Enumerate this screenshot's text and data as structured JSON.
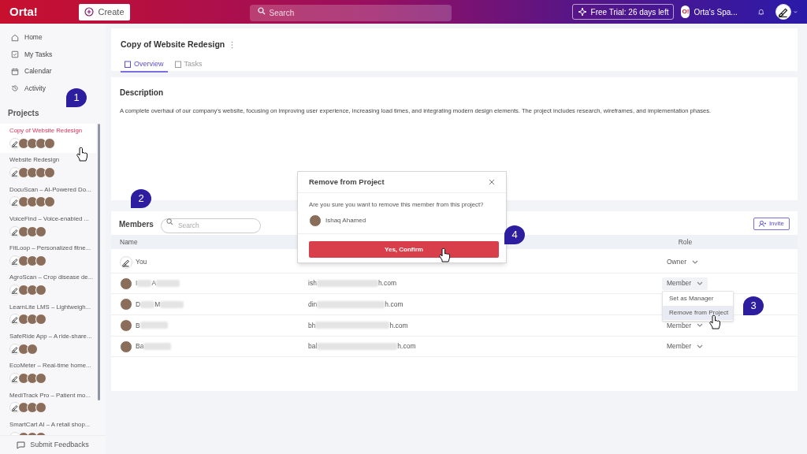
{
  "header": {
    "logo": "Orta!",
    "create_button": "Create",
    "search": {
      "placeholder": "Search"
    },
    "trial_badge": "Free Trial: 26 days left",
    "workspace": "Orta's Spa...",
    "workspace_logo": "O!"
  },
  "sidebar": {
    "nav": [
      {
        "label": "Home"
      },
      {
        "label": "My Tasks"
      },
      {
        "label": "Calendar"
      },
      {
        "label": "Activity"
      }
    ],
    "projects_heading": "Projects",
    "projects": [
      {
        "name": "Copy of Website Redesign",
        "selected": true,
        "avatars": [
          {
            "kind": "sketch"
          },
          {
            "kind": "photo"
          },
          {
            "kind": "photo"
          },
          {
            "kind": "photo"
          },
          {
            "kind": "photo"
          }
        ]
      },
      {
        "name": "Website Redesign",
        "selected": false,
        "avatars": [
          {
            "kind": "sketch"
          },
          {
            "kind": "photo"
          },
          {
            "kind": "photo"
          },
          {
            "kind": "photo"
          },
          {
            "kind": "photo"
          }
        ]
      },
      {
        "name": "DocuScan – AI-Powered Do...",
        "selected": false,
        "avatars": [
          {
            "kind": "sketch"
          },
          {
            "kind": "photo"
          },
          {
            "kind": "photo"
          },
          {
            "kind": "photo"
          },
          {
            "kind": "photo"
          }
        ]
      },
      {
        "name": "VoiceFind – Voice-enabled ...",
        "selected": false,
        "avatars": [
          {
            "kind": "sketch"
          },
          {
            "kind": "photo"
          },
          {
            "kind": "photo"
          },
          {
            "kind": "photo"
          }
        ]
      },
      {
        "name": "FitLoop – Personalized fitne...",
        "selected": false,
        "avatars": [
          {
            "kind": "sketch"
          },
          {
            "kind": "photo"
          },
          {
            "kind": "photo"
          },
          {
            "kind": "photo"
          }
        ]
      },
      {
        "name": "AgroScan – Crop disease de...",
        "selected": false,
        "avatars": [
          {
            "kind": "sketch"
          },
          {
            "kind": "photo"
          },
          {
            "kind": "photo"
          },
          {
            "kind": "photo"
          }
        ]
      },
      {
        "name": "LearnLite LMS – Lightweigh...",
        "selected": false,
        "avatars": [
          {
            "kind": "sketch"
          },
          {
            "kind": "photo"
          },
          {
            "kind": "photo"
          },
          {
            "kind": "photo"
          }
        ]
      },
      {
        "name": "SafeRide App – A ride-share...",
        "selected": false,
        "avatars": [
          {
            "kind": "sketch"
          },
          {
            "kind": "photo"
          },
          {
            "kind": "photo"
          }
        ]
      },
      {
        "name": "EcoMeter – Real-time home...",
        "selected": false,
        "avatars": [
          {
            "kind": "sketch"
          },
          {
            "kind": "photo"
          },
          {
            "kind": "photo"
          },
          {
            "kind": "photo"
          }
        ]
      },
      {
        "name": "MediTrack Pro – Patient mo...",
        "selected": false,
        "avatars": [
          {
            "kind": "sketch"
          },
          {
            "kind": "photo"
          },
          {
            "kind": "photo"
          },
          {
            "kind": "photo"
          }
        ]
      },
      {
        "name": "SmartCart AI – A retail shop...",
        "selected": false,
        "avatars": [
          {
            "kind": "sketch"
          },
          {
            "kind": "photo"
          },
          {
            "kind": "photo"
          },
          {
            "kind": "photo"
          }
        ]
      }
    ],
    "feedback": "Submit Feedbacks"
  },
  "project": {
    "title": "Copy of Website Redesign",
    "tabs": [
      {
        "label": "Overview",
        "selected": true
      },
      {
        "label": "Tasks",
        "selected": false
      }
    ]
  },
  "description": {
    "heading": "Description",
    "text": "A complete overhaul of our company's website, focusing on improving user experience, increasing load times, and integrating modern design elements. The project includes research, wireframes, and implementation phases."
  },
  "members": {
    "heading": "Members",
    "search": {
      "placeholder": "Search"
    },
    "invite_button": "Invite",
    "columns": {
      "name": "Name",
      "role": "Role"
    },
    "rows": [
      {
        "avatar": {
          "kind": "sketch"
        },
        "name_fragments": [
          "You"
        ],
        "email_fragments": [],
        "role": "Owner"
      },
      {
        "avatar": {
          "kind": "photo"
        },
        "name_fragments": [
          "I",
          "A"
        ],
        "email_fragments": [
          "ish",
          "h.com"
        ],
        "role": "Member",
        "menu": [
          {
            "label": "Set as Manager",
            "selected": false
          },
          {
            "label": "Remove from Project",
            "selected": true
          }
        ]
      },
      {
        "avatar": {
          "kind": "photo"
        },
        "name_fragments": [
          "D",
          "M"
        ],
        "email_fragments": [
          "din",
          "h.com"
        ]
      },
      {
        "avatar": {
          "kind": "photo"
        },
        "name_fragments": [
          "B"
        ],
        "email_fragments": [
          "bh",
          "h.com"
        ],
        "role": "Member"
      },
      {
        "avatar": {
          "kind": "photo"
        },
        "name_fragments": [
          "Ba"
        ],
        "email_fragments": [
          "bal",
          "h.com"
        ],
        "role": "Member"
      }
    ]
  },
  "dialog": {
    "title": "Remove from Project",
    "message": "Are you sure you want to remove this member from this project?",
    "member": "Ishaq Ahamed",
    "confirm_button": "Yes, Confirm"
  },
  "annotations": [
    "1",
    "2",
    "3",
    "4"
  ]
}
